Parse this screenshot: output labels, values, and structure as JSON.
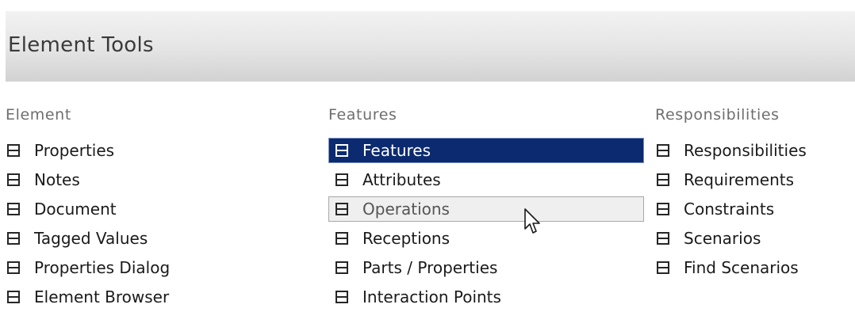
{
  "header": {
    "title": "Element Tools"
  },
  "columns": {
    "element": {
      "heading": "Element",
      "items": [
        {
          "label": "Properties",
          "icon": "panel-icon"
        },
        {
          "label": "Notes",
          "icon": "panel-icon"
        },
        {
          "label": "Document",
          "icon": "panel-icon"
        },
        {
          "label": "Tagged Values",
          "icon": "panel-icon"
        },
        {
          "label": "Properties Dialog",
          "icon": "panel-icon"
        },
        {
          "label": "Element Browser",
          "icon": "panel-icon"
        }
      ]
    },
    "features": {
      "heading": "Features",
      "items": [
        {
          "label": "Features",
          "icon": "panel-icon",
          "state": "selected"
        },
        {
          "label": "Attributes",
          "icon": "panel-icon"
        },
        {
          "label": "Operations",
          "icon": "panel-icon",
          "state": "hover"
        },
        {
          "label": "Receptions",
          "icon": "panel-icon"
        },
        {
          "label": "Parts / Properties",
          "icon": "panel-icon"
        },
        {
          "label": "Interaction Points",
          "icon": "panel-icon"
        }
      ]
    },
    "responsibilities": {
      "heading": "Responsibilities",
      "items": [
        {
          "label": "Responsibilities",
          "icon": "panel-icon"
        },
        {
          "label": "Requirements",
          "icon": "panel-icon"
        },
        {
          "label": "Constraints",
          "icon": "panel-icon"
        },
        {
          "label": "Scenarios",
          "icon": "panel-icon"
        },
        {
          "label": "Find Scenarios",
          "icon": "panel-icon"
        }
      ]
    }
  },
  "colors": {
    "selected_background": "#0b2a6f",
    "hover_background": "#efefef",
    "header_gradient_top": "#f2f2f2",
    "header_gradient_bottom": "#d2d2d2"
  }
}
